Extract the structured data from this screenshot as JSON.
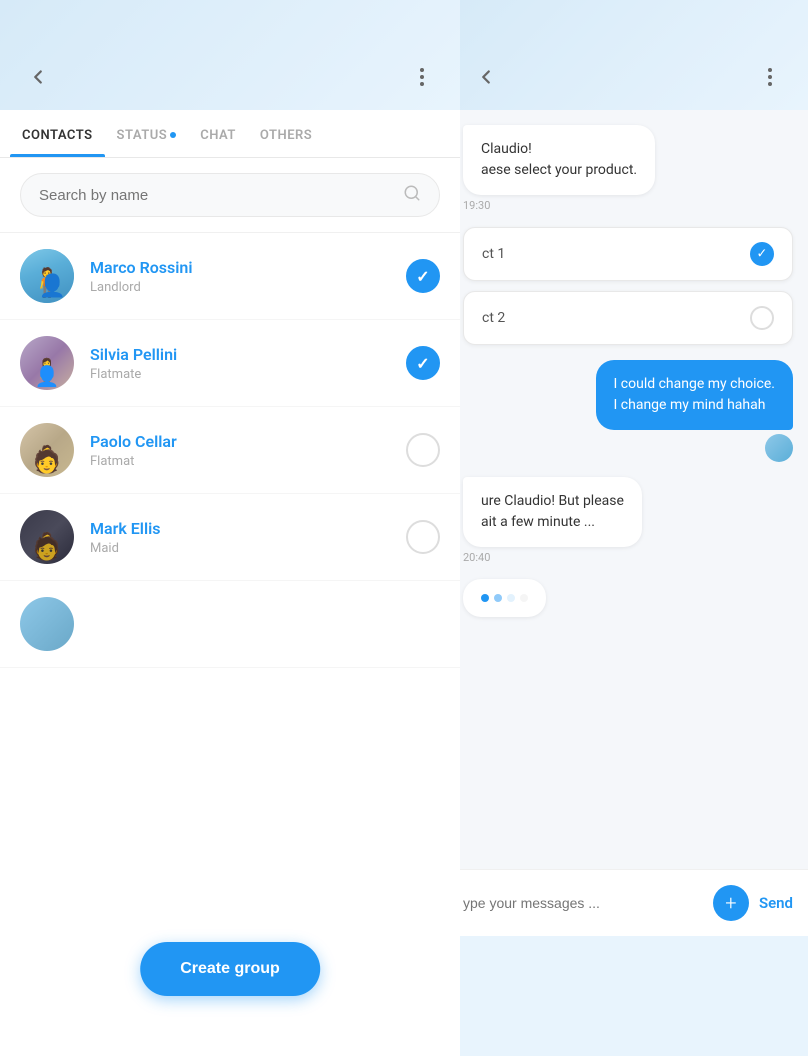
{
  "leftPanel": {
    "tabs": [
      {
        "id": "contacts",
        "label": "CONTACTS",
        "active": true
      },
      {
        "id": "status",
        "label": "STATUS",
        "hasDot": true,
        "active": false
      },
      {
        "id": "chat",
        "label": "CHAT",
        "active": false
      },
      {
        "id": "others",
        "label": "OTHERS",
        "active": false
      }
    ],
    "search": {
      "placeholder": "Search by name"
    },
    "contacts": [
      {
        "id": 1,
        "name": "Marco Rossini",
        "role": "Landlord",
        "selected": true,
        "avatarType": "marco"
      },
      {
        "id": 2,
        "name": "Silvia Pellini",
        "role": "Flatmate",
        "selected": true,
        "avatarType": "silvia"
      },
      {
        "id": 3,
        "name": "Paolo Cellar",
        "role": "Flatmat",
        "selected": false,
        "avatarType": "paolo"
      },
      {
        "id": 4,
        "name": "Mark Ellis",
        "role": "Maid",
        "selected": false,
        "avatarType": "mark"
      }
    ],
    "createGroupBtn": "Create group"
  },
  "rightPanel": {
    "messages": [
      {
        "id": 1,
        "type": "received",
        "text": "Claudio!\naese select your product.",
        "time": "19:30",
        "truncated": true
      },
      {
        "id": 2,
        "type": "options",
        "options": [
          {
            "label": "ct 1",
            "selected": true
          },
          {
            "label": "ct 2",
            "selected": false
          }
        ]
      },
      {
        "id": 3,
        "type": "sent",
        "text": "I could change my choice.\nI change my mind hahah",
        "time": null
      },
      {
        "id": 4,
        "type": "received",
        "text": "ure Claudio! But please\nait a few minute ...",
        "time": "20:40",
        "truncated": true
      },
      {
        "id": 5,
        "type": "typing"
      }
    ],
    "input": {
      "placeholder": "ype your messages ...",
      "addBtn": "+",
      "sendBtn": "Send"
    }
  },
  "icons": {
    "back": "←",
    "more": "⋮",
    "search": "○",
    "check": "✓"
  }
}
